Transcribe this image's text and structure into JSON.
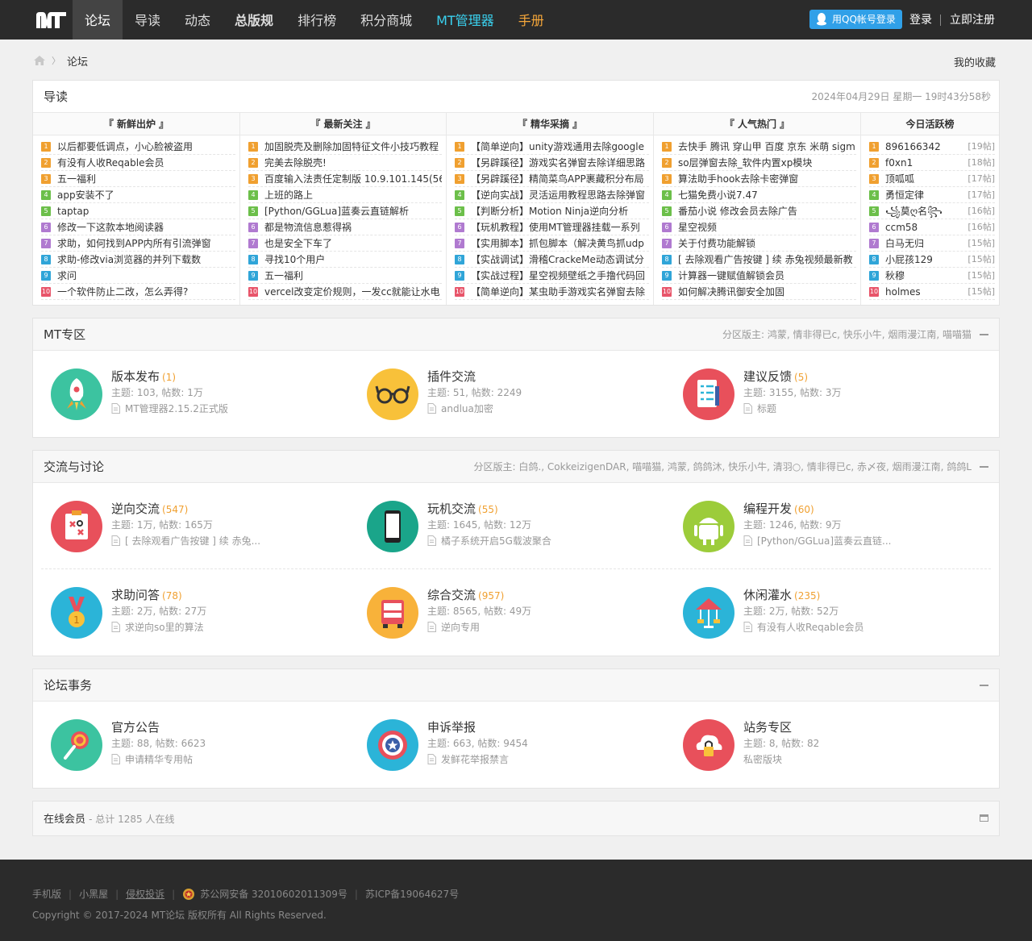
{
  "nav": {
    "items": [
      "论坛",
      "导读",
      "动态",
      "总版规",
      "排行榜",
      "积分商城",
      "MT管理器",
      "手册"
    ],
    "qq_login": "用QQ帐号登录",
    "login": "登录",
    "register": "立即注册"
  },
  "crumb": {
    "current": "论坛"
  },
  "favorites": "我的收藏",
  "daodu": {
    "title": "导读",
    "date": "2024年04月29日 星期一 19时43分58秒",
    "columns": [
      {
        "title": "『 新鲜出炉 』",
        "items": [
          "以后都要低调点，小心脸被盗用",
          "有没有人收Reqable会员",
          "五一福利",
          "app安装不了",
          "taptap",
          "修改一下这款本地阅读器",
          "求助，如何找到APP内所有引流弹窗",
          "求助-修改via浏览器的并列下载数",
          "求问",
          "一个软件防止二改，怎么弄得?"
        ]
      },
      {
        "title": "『 最新关注 』",
        "items": [
          "加固脱壳及删除加固特征文件小技巧教程",
          "完美去除脱壳!",
          "百度输入法责任定制版 10.9.101.145(56",
          "上班的路上",
          "[Python/GGLua]蓝奏云直链解析",
          "都是物流信息惹得祸",
          "也是安全下车了",
          "寻找10个用户",
          "五一福利",
          "vercel改变定价规则，一发cc就能让水电"
        ]
      },
      {
        "title": "『 精华采摘 』",
        "items": [
          "【简单逆向】unity游戏通用去除google",
          "【另辟蹊径】游戏实名弹窗去除详细思路",
          "【另辟蹊径】精简菜鸟APP裹藏积分布局",
          "【逆向实战】灵活运用教程思路去除弹窗",
          "【判断分析】Motion Ninja逆向分析",
          "【玩机教程】使用MT管理器挂载一系列",
          "【实用脚本】抓包脚本（解决黄鸟抓udp",
          "【实战调试】滑稽CrackeMe动态调试分",
          "【实战过程】星空视频壁纸之手撸代码回",
          "【简单逆向】某虫助手游戏实名弹窗去除"
        ]
      },
      {
        "title": "『 人气热门 』",
        "items": [
          "去快手 腾讯 穿山甲 百度 京东 米萌 sigm",
          "so层弹窗去除_软件内置xp模块",
          "算法助手hook去除卡密弹窗",
          "七猫免费小说7.47",
          "番茄小说 修改会员去除广告",
          "星空视频",
          "关于付费功能解锁",
          "[ 去除观看广告按键 ] 续 赤兔视频最新教",
          "计算器一键赋值解锁会员",
          "如何解决腾讯御安全加固"
        ]
      },
      {
        "title": "今日活跃榜",
        "items": [
          "896166342",
          "f0xn1",
          "顶呱呱",
          "勇恒定律",
          "꧁莫ღ名꧂",
          "ccm58",
          "白马无归",
          "小屁孩129",
          "秋穆",
          "holmes"
        ],
        "counts": [
          "[19帖]",
          "[18帖]",
          "[17帖]",
          "[17帖]",
          "[16帖]",
          "[16帖]",
          "[15帖]",
          "[15帖]",
          "[15帖]",
          "[15帖]"
        ]
      }
    ]
  },
  "sections": [
    {
      "title": "MT专区",
      "mods": "分区版主: 鸿蒙, 情非得已c, 快乐小牛, 烟雨漫江南, 喵喵猫",
      "forums": [
        {
          "name": "版本发布",
          "today": "(1)",
          "stats": "主题: 103, 帖数: 1万",
          "last": "MT管理器2.15.2正式版",
          "icon": "rocket-icon",
          "color": "#3cc3a0"
        },
        {
          "name": "插件交流",
          "today": "",
          "stats": "主题: 51, 帖数: 2249",
          "last": "andlua加密",
          "icon": "glasses-icon",
          "color": "#f8c13a"
        },
        {
          "name": "建议反馈",
          "today": "(5)",
          "stats": "主题: 3155, 帖数: 3万",
          "last": "标题",
          "icon": "checklist-icon",
          "color": "#e8505b"
        }
      ]
    },
    {
      "title": "交流与讨论",
      "mods": "分区版主: 白鸽., CokkeizigenDAR, 喵喵猫, 鸿蒙, 鸽鸽沐, 快乐小牛, 清羽○, 情非得已c, 赤〆夜, 烟雨漫江南, 鸽鸽L",
      "forums": [
        {
          "name": "逆向交流",
          "today": "(547)",
          "stats": "主题: 1万, 帖数: 165万",
          "last": "[ 去除观看广告按键 ] 续 赤兔...",
          "icon": "tactics-icon",
          "color": "#e8505b"
        },
        {
          "name": "玩机交流",
          "today": "(55)",
          "stats": "主题: 1645, 帖数: 12万",
          "last": "橘子系统开启5G载波聚合",
          "icon": "phone-icon",
          "color": "#1aa58a"
        },
        {
          "name": "编程开发",
          "today": "(60)",
          "stats": "主题: 1246, 帖数: 9万",
          "last": "[Python/GGLua]蓝奏云直链...",
          "icon": "android-icon",
          "color": "#9ccc3a"
        },
        {
          "name": "求助问答",
          "today": "(78)",
          "stats": "主题: 2万, 帖数: 27万",
          "last": "求逆向so里的算法",
          "icon": "medal-icon",
          "color": "#2bb4d8"
        },
        {
          "name": "综合交流",
          "today": "(957)",
          "stats": "主题: 8565, 帖数: 49万",
          "last": "逆向专用",
          "icon": "bus-icon",
          "color": "#f8b23a"
        },
        {
          "name": "休闲灌水",
          "today": "(235)",
          "stats": "主题: 2万, 帖数: 52万",
          "last": "有没有人收Reqable会员",
          "icon": "carousel-icon",
          "color": "#2bb4d8"
        }
      ]
    },
    {
      "title": "论坛事务",
      "mods": "",
      "forums": [
        {
          "name": "官方公告",
          "today": "",
          "stats": "主题: 88, 帖数: 6623",
          "last": "申请精华专用帖",
          "icon": "lollipop-icon",
          "color": "#3cc3a0"
        },
        {
          "name": "申诉举报",
          "today": "",
          "stats": "主题: 663, 帖数: 9454",
          "last": "发鲜花举报禁言",
          "icon": "shield-icon",
          "color": "#2bb4d8"
        },
        {
          "name": "站务专区",
          "today": "",
          "stats": "主题: 8, 帖数: 82",
          "last": "私密版块",
          "icon": "cloud-lock-icon",
          "color": "#e8505b"
        }
      ]
    }
  ],
  "online": {
    "title": "在线会员",
    "sub": "- 总计 1285 人在线"
  },
  "footer": {
    "links": [
      "手机版",
      "小黑屋",
      "侵权投诉"
    ],
    "police": "苏公网安备 32010602011309号",
    "icp": "苏ICP备19064627号",
    "copyright": "Copyright © 2017-2024 MT论坛 版权所有 All Rights Reserved."
  }
}
